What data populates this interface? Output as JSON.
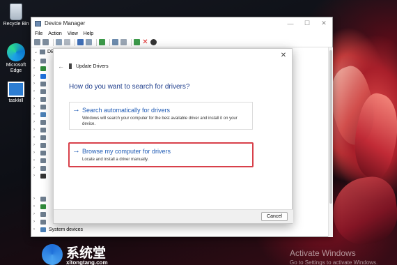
{
  "desktop": {
    "icons": [
      {
        "label": "Recycle Bin"
      },
      {
        "label": "Microsoft Edge"
      },
      {
        "label": "taskkill"
      }
    ],
    "activate_title": "Activate Windows",
    "activate_sub": "Go to Settings to activate Windows.",
    "brand_text": "系统堂",
    "brand_url": "xitongtang.com"
  },
  "device_manager": {
    "title": "Device Manager",
    "menu": [
      "File",
      "Action",
      "View",
      "Help"
    ],
    "tree_root": "DE",
    "bottom_item": "System devices",
    "window_buttons": {
      "minimize": "—",
      "maximize": "☐",
      "close": "✕"
    }
  },
  "dialog": {
    "header": "Update Drivers",
    "question": "How do you want to search for drivers?",
    "option_auto": {
      "title": "Search automatically for drivers",
      "description": "Windows will search your computer for the best available driver and install it on your device."
    },
    "option_browse": {
      "title": "Browse my computer for drivers",
      "description": "Locate and install a driver manually."
    },
    "cancel_label": "Cancel",
    "close_glyph": "✕",
    "back_glyph": "←",
    "arrow_glyph": "→"
  },
  "colors": {
    "accent_blue": "#1f5bb5",
    "highlight_red": "#d8404a"
  }
}
